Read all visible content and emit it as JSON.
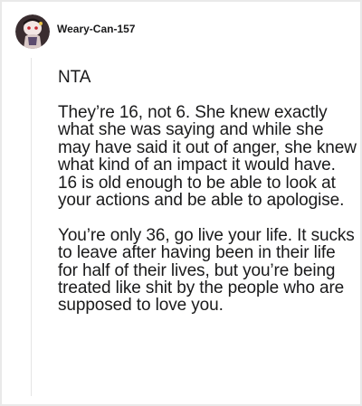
{
  "comment": {
    "author": "Weary-Can-157",
    "avatar_icon": "snoo-avatar-icon",
    "paragraphs": [
      "NTA",
      "They’re 16, not 6. She knew exactly what she was saying and while she may have said it out of anger, she knew what kind of an impact it would have. 16 is old enough to be able to look at your actions and be able to apologise.",
      "You’re only 36, go live your life. It sucks to leave after having been in their life for half of their lives, but you’re being treated like shit by the people who are supposed to love you."
    ]
  },
  "colors": {
    "background": "#e9e9e9",
    "card": "#ffffff",
    "text": "#1a1a1b",
    "avatar_bg": "#3a2d30"
  }
}
